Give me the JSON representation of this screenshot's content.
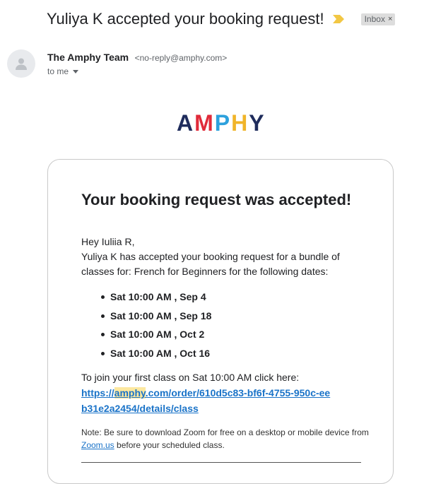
{
  "email": {
    "subject": "Yuliya K accepted your booking request!",
    "label_chip": "Inbox",
    "label_chip_close": "×",
    "sender_name": "The Amphy Team",
    "sender_email": "<no-reply@amphy.com>",
    "to_line": "to me"
  },
  "logo": {
    "text": "AMPHY",
    "letter_colors": [
      "#1f2c5c",
      "#e02b3a",
      "#2da1dd",
      "#f0b429",
      "#1f2c5c"
    ]
  },
  "card": {
    "title": "Your booking request was accepted!",
    "greeting": "Hey Iuliia R,",
    "intro": "Yuliya K has accepted your booking request for a bundle of classes for: French for Beginners for the following dates:",
    "dates": [
      "Sat 10:00 AM , Sep 4",
      "Sat 10:00 AM , Sep 18",
      "Sat 10:00 AM , Oct 2",
      "Sat 10:00 AM , Oct 16"
    ],
    "join_text": "To join your first class on Sat 10:00 AM click here:",
    "link": {
      "before": "https://",
      "highlight": "amphy",
      "after": ".com/order/610d5c83-bf6f-4755-950c-eeb31e2a2454/details/class"
    },
    "note_before": "Note: Be sure to download Zoom for free on a desktop or mobile device from ",
    "note_link": "Zoom.us",
    "note_after": " before your scheduled class."
  }
}
